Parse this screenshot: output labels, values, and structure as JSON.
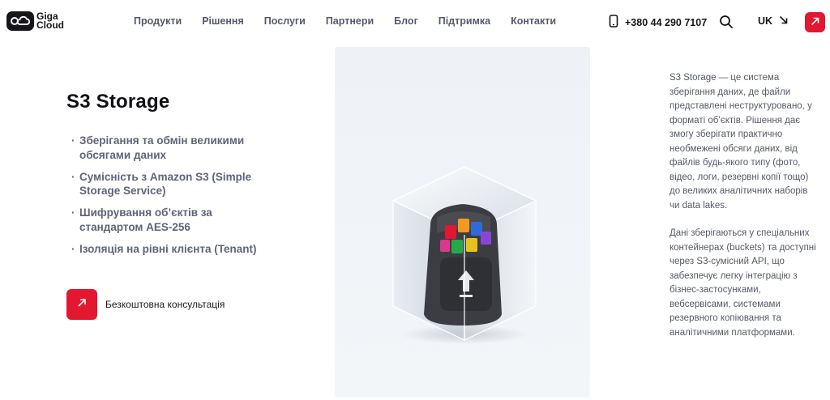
{
  "header": {
    "logo": {
      "line1": "Giga",
      "line2": "Cloud"
    },
    "nav": [
      {
        "label": "Продукти"
      },
      {
        "label": "Рішення"
      },
      {
        "label": "Послуги"
      },
      {
        "label": "Партнери"
      },
      {
        "label": "Блог"
      },
      {
        "label": "Підтримка"
      },
      {
        "label": "Контакти"
      }
    ],
    "phone": "+380 44 290 7107",
    "language": "UK"
  },
  "main": {
    "title": "S3 Storage",
    "features": [
      "Зберігання та обмін великими обсягами даних",
      "Сумісність з Amazon S3 (Simple Storage Service)",
      "Шифрування об’єктів за стандартом AES-256",
      "Ізоляція на рівні клієнта (Tenant)"
    ],
    "consult_label": "Безкоштовна консультація",
    "description": [
      "S3 Storage — це система зберігання даних, де файли представлені неструктуровано, у форматі об’єктів. Рішення дає змогу зберігати практично необмежені обсяги даних, від файлів будь-якого типу (фото, відео, логи, резервні копії тощо) до великих аналітичних наборів чи data lakes.",
      "Дані зберігаються у спеціальних контейнерах (buckets) та доступні через S3-сумісний API, що забезпечує легку інтеграцію з бізнес-застосунками, вебсервісами, системами резервного копіювання та аналітичними платформами."
    ]
  },
  "colors": {
    "accent": "#e3172f",
    "text_dark": "#16161a",
    "text_muted": "#5e6478",
    "panel_bg": "#eef2f7"
  },
  "icons": [
    "cloud-logo-icon",
    "phone-icon",
    "search-icon",
    "arrow-down-right-icon",
    "arrow-up-right-icon"
  ]
}
